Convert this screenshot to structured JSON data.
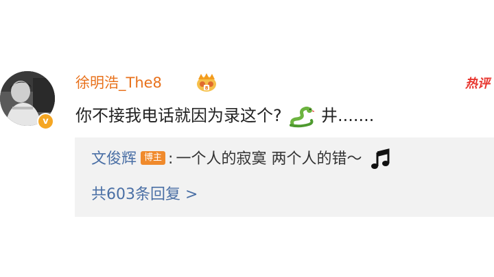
{
  "comment": {
    "username": "徐明浩_The8",
    "crown_badge_icon": "crown-badge-icon",
    "verified_badge": "v",
    "hot_tag": "热评",
    "text_before_emoji": "你不接我电话就因为录这个?",
    "emoji": "snake-icon",
    "text_after_emoji": "井......."
  },
  "reply": {
    "author": "文俊辉",
    "host_badge": "博主",
    "colon": ":",
    "text": "一个人的寂寞 两个人的错～",
    "emoji": "music-note-icon",
    "more_replies": "共603条回复 >"
  },
  "colors": {
    "username": "#e8711b",
    "hot_tag": "#e8352e",
    "link": "#4a6fa5",
    "host_badge": "#f08a2c",
    "reply_bg": "#f2f2f2",
    "verified": "#f5a623"
  }
}
